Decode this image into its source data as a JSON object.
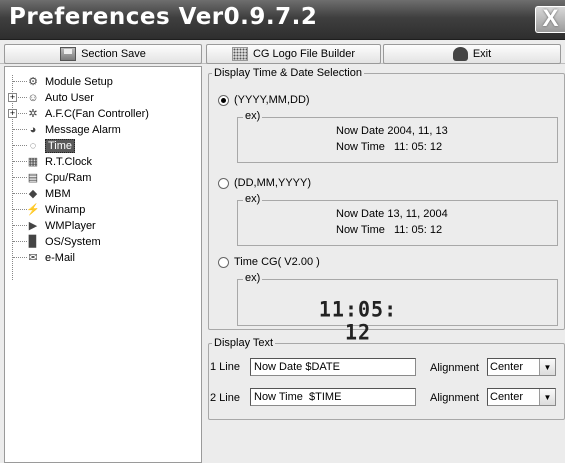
{
  "window": {
    "title": "Preferences Ver0.9.7.2",
    "close_glyph": "X"
  },
  "toolbar": {
    "section_save": {
      "label": "Section Save",
      "icon": "save-icon"
    },
    "cg_logo": {
      "label": "CG Logo File Builder",
      "icon": "grid-icon"
    },
    "exit": {
      "label": "Exit",
      "icon": "exit-icon"
    }
  },
  "tree": {
    "items": [
      {
        "label": "Module Setup",
        "icon": "module-icon",
        "expandable": false,
        "selected": false
      },
      {
        "label": "Auto User",
        "icon": "users-icon",
        "expandable": true,
        "selected": false
      },
      {
        "label": "A.F.C(Fan Controller)",
        "icon": "fan-icon",
        "expandable": true,
        "selected": false
      },
      {
        "label": "Message Alarm",
        "icon": "alarm-icon",
        "expandable": false,
        "selected": false
      },
      {
        "label": "Time",
        "icon": "clock-icon",
        "expandable": false,
        "selected": true
      },
      {
        "label": "R.T.Clock",
        "icon": "rtclock-icon",
        "expandable": false,
        "selected": false
      },
      {
        "label": "Cpu/Ram",
        "icon": "cpu-icon",
        "expandable": false,
        "selected": false
      },
      {
        "label": "MBM",
        "icon": "mbm-icon",
        "expandable": false,
        "selected": false
      },
      {
        "label": "Winamp",
        "icon": "winamp-icon",
        "expandable": false,
        "selected": false
      },
      {
        "label": "WMPlayer",
        "icon": "wmplayer-icon",
        "expandable": false,
        "selected": false
      },
      {
        "label": "OS/System",
        "icon": "os-icon",
        "expandable": false,
        "selected": false
      },
      {
        "label": "e-Mail",
        "icon": "email-icon",
        "expandable": false,
        "selected": false
      }
    ]
  },
  "display_selection": {
    "legend": "Display Time & Date Selection",
    "options": [
      {
        "label": "(YYYY,MM,DD)",
        "checked": true,
        "ex_legend": "ex)",
        "date_label": "Now Date",
        "date_value": "2004, 11, 13",
        "time_label": "Now Time",
        "time_value": "11: 05: 12"
      },
      {
        "label": "(DD,MM,YYYY)",
        "checked": false,
        "ex_legend": "ex)",
        "date_label": "Now Date",
        "date_value": "13, 11, 2004",
        "time_label": "Now Time",
        "time_value": "11: 05: 12"
      },
      {
        "label": "Time CG( V2.00 )",
        "checked": false,
        "ex_legend": "ex)",
        "lcd_value": "11:05: 12"
      }
    ]
  },
  "display_text": {
    "legend": "Display Text",
    "rows": [
      {
        "label": "1 Line",
        "value": "Now Date $DATE",
        "alignment_label": "Alignment",
        "alignment": "Center"
      },
      {
        "label": "2 Line",
        "value": "Now Time  $TIME",
        "alignment_label": "Alignment",
        "alignment": "Center"
      }
    ]
  }
}
